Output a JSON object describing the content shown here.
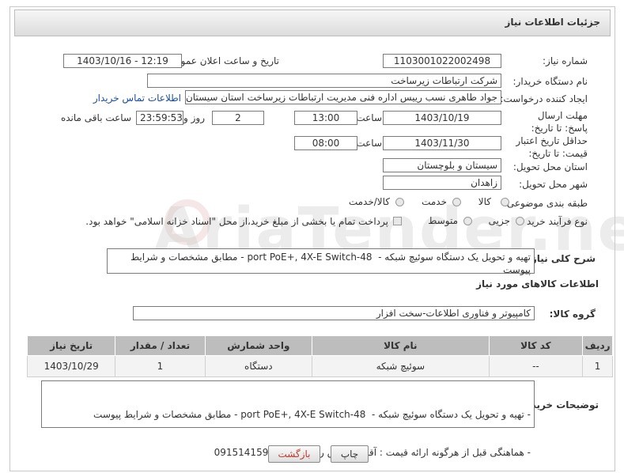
{
  "header": {
    "title": "جزئیات اطلاعات نیاز"
  },
  "fields": {
    "need_number_label": "شماره نیاز:",
    "need_number": "1103001022002498",
    "announce_label": "تاریخ و ساعت اعلان عمومی:",
    "announce_value": "1403/10/16 - 12:19",
    "buyer_label": "نام دستگاه خریدار:",
    "buyer_value": "شرکت ارتباطات زیرساخت",
    "creator_label": "ایجاد کننده درخواست:",
    "creator_value": "جواد طاهری نسب رییس اداره فنی مدیریت ارتباطات زیرساخت استان سیستان و",
    "contact_link": "اطلاعات تماس خریدار",
    "deadline_label": "مهلت ارسال پاسخ: تا تاریخ:",
    "deadline_date": "1403/10/19",
    "time_label": "ساعت",
    "deadline_time": "13:00",
    "days_value": "2",
    "days_label": "روز و",
    "remaining_value": "23:59:53",
    "remaining_label": "ساعت باقی مانده",
    "validity_label": "حداقل تاریخ اعتبار قیمت: تا تاریخ:",
    "validity_date": "1403/11/30",
    "validity_time": "08:00",
    "province_label": "استان محل تحویل:",
    "province_value": "سیستان و بلوچستان",
    "city_label": "شهر محل تحویل:",
    "city_value": "زاهدان",
    "category_label": "طبقه بندی موضوعی:",
    "category_options": [
      "کالا",
      "خدمت",
      "کالا/خدمت"
    ],
    "process_label": "نوع فرآیند خرید :",
    "process_options": [
      "جزیی",
      "متوسط"
    ],
    "payment_note": "پرداخت تمام یا بخشی از مبلغ خرید،از محل \"اسناد خزانه اسلامی\" خواهد بود."
  },
  "description": {
    "label": "شرح کلی نیاز:",
    "value": "تهیه و تحویل یک دستگاه سوئیچ شبکه -  port PoE+, 4X-E Switch-48 - مطابق مشخصات و شرایط پیوست"
  },
  "goods_info": {
    "title": "اطلاعات کالاهای مورد نیاز",
    "group_label": "گروه کالا:",
    "group_value": "کامپیوتر و فناوری اطلاعات-سخت افزار"
  },
  "table": {
    "headers": [
      "ردیف",
      "کد کالا",
      "نام کالا",
      "واحد شمارش",
      "تعداد / مقدار",
      "تاریخ نیاز"
    ],
    "rows": [
      [
        "1",
        "--",
        "سوئیچ شبکه",
        "دستگاه",
        "1",
        "1403/10/29"
      ]
    ]
  },
  "buyer_notes": {
    "label": "توضیحات خریدار:",
    "line1": "- تهیه و تحویل یک دستگاه سوئیچ شبکه -  port PoE+, 4X-E Switch-48 - مطابق مشخصات و شرایط پیوست",
    "line2": "- هماهنگی قبل از هرگونه ارائه قیمت : آقای مهندس رهسپار  :  09151415906"
  },
  "buttons": {
    "print": "چاپ",
    "back": "بازگشت"
  },
  "watermark": "AriaTender.neT"
}
